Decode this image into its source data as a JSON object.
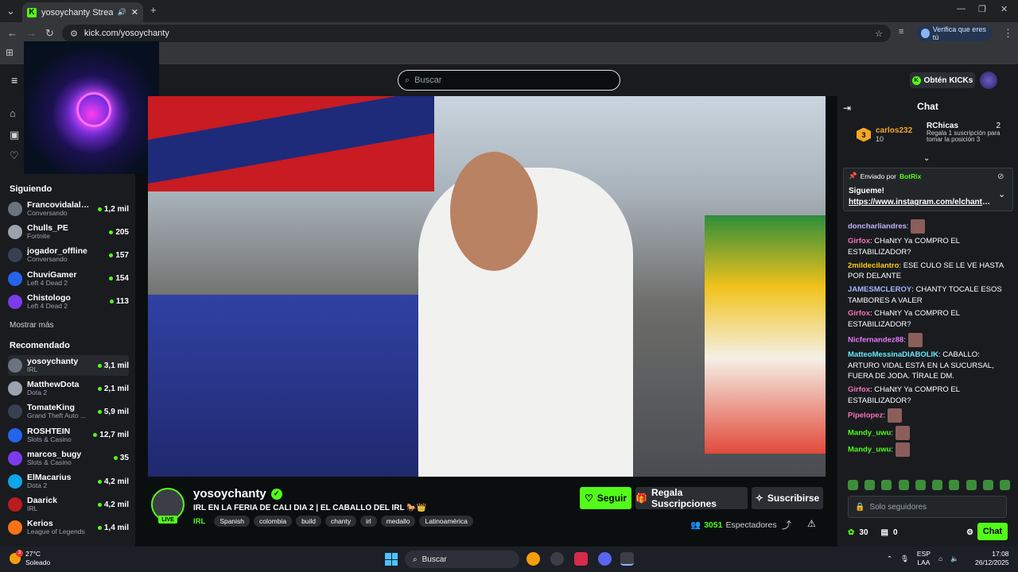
{
  "browser": {
    "tab_title": "yosoychanty Stream - Watc",
    "url": "kick.com/yosoychanty",
    "verify_label": "Verifica que eres tú"
  },
  "header": {
    "search_placeholder": "Buscar",
    "get_kicks_label": "Obtén KICKs"
  },
  "sidebar": {
    "following_title": "Siguiendo",
    "following": [
      {
        "name": "Francovidalalca...",
        "category": "Conversando",
        "viewers": "1,2 mil"
      },
      {
        "name": "Chulls_PE",
        "category": "Fortnite",
        "viewers": "205"
      },
      {
        "name": "jogador_offline",
        "category": "Conversando",
        "viewers": "157"
      },
      {
        "name": "ChuviGamer",
        "category": "Left 4 Dead 2",
        "viewers": "154"
      },
      {
        "name": "Chistologo",
        "category": "Left 4 Dead 2",
        "viewers": "113"
      }
    ],
    "show_more": "Mostrar más",
    "recommended_title": "Recomendado",
    "recommended": [
      {
        "name": "yosoychanty",
        "category": "IRL",
        "viewers": "3,1 mil"
      },
      {
        "name": "MatthewDota",
        "category": "Dota 2",
        "viewers": "2,1 mil"
      },
      {
        "name": "TomateKing",
        "category": "Grand Theft Auto ...",
        "viewers": "5,9 mil"
      },
      {
        "name": "ROSHTEIN",
        "category": "Slots & Casino",
        "viewers": "12,7 mil"
      },
      {
        "name": "marcos_bugy",
        "category": "Slots & Casino",
        "viewers": "35"
      },
      {
        "name": "ElMacarius",
        "category": "Dota 2",
        "viewers": "4,2 mil"
      },
      {
        "name": "Daarick",
        "category": "IRL",
        "viewers": "4,2 mil"
      },
      {
        "name": "Kerios",
        "category": "League of Legends",
        "viewers": "1,4 mil"
      }
    ]
  },
  "stream": {
    "channel": "yosoychanty",
    "live_label": "LIVE",
    "title": "IRL EN LA FERIA DE CALI DIA 2 | EL CABALLO DEL IRL 🐎👑",
    "category": "IRL",
    "tags": [
      "Spanish",
      "colombia",
      "build",
      "chanty",
      "irl",
      "medallo",
      "Latinoamérica"
    ],
    "follow_label": "Seguir",
    "gift_label": "Regala Suscripciones",
    "subscribe_label": "Suscribirse",
    "viewers_count": "3051",
    "viewers_label": "Espectadores"
  },
  "chat": {
    "title": "Chat",
    "leaderboard": {
      "rank": "3",
      "top_name": "carlos232",
      "top_count": "10",
      "gift_name": "RChicas",
      "gift_count": "2",
      "gift_desc": "Regala 1 suscripción para tomar la posición 3"
    },
    "pinned": {
      "by": "Enviado por",
      "by_name": "BotRix",
      "message": "Sigueme!",
      "link": "https://www.instagram.com/elchanty..."
    },
    "messages": [
      {
        "user": "doncharliandres",
        "color": "#c4b5fd",
        "text": ""
      },
      {
        "user": "Girfox",
        "color": "#f472b6",
        "text": "CHaNtY Ya COMPRO EL ESTABILIZADOR?"
      },
      {
        "user": "2mildecilantro",
        "color": "#facc15",
        "text": "ESE CULO SE LE VE HASTA POR DELANTE"
      },
      {
        "user": "JAMESMCLEROY",
        "color": "#a5b4fc",
        "text": "CHANTY TOCALE ESOS TAMBORES A VALER"
      },
      {
        "user": "Girfox",
        "color": "#f472b6",
        "text": "CHaNtY Ya COMPRO EL ESTABILIZADOR?"
      },
      {
        "user": "Nicfernandez88",
        "color": "#e879f9",
        "text": ""
      },
      {
        "user": "MatteoMessinaDIABOLIK",
        "color": "#67e8f9",
        "text": "CABALLO: ARTURO VIDAL ESTÁ EN LA SUCURSAL, FUERA DE JODA. TÍRALE DM."
      },
      {
        "user": "Girfox",
        "color": "#f472b6",
        "text": "CHaNtY Ya COMPRO EL ESTABILIZADOR?"
      },
      {
        "user": "Pipelopez",
        "color": "#f472b6",
        "text": ""
      },
      {
        "user": "Mandy_uwu",
        "color": "#53fc18",
        "text": ""
      },
      {
        "user": "Mandy_uwu",
        "color": "#53fc18",
        "text": ""
      }
    ],
    "input_placeholder": "Solo seguidores",
    "points": "30",
    "chest_count": "0",
    "send_label": "Chat"
  },
  "taskbar": {
    "temp": "27°C",
    "condition": "Soleado",
    "search_placeholder": "Buscar",
    "lang": "ESP",
    "lang2": "LAA",
    "time": "17:08",
    "date": "26/12/2025",
    "weather_badge": "3"
  }
}
